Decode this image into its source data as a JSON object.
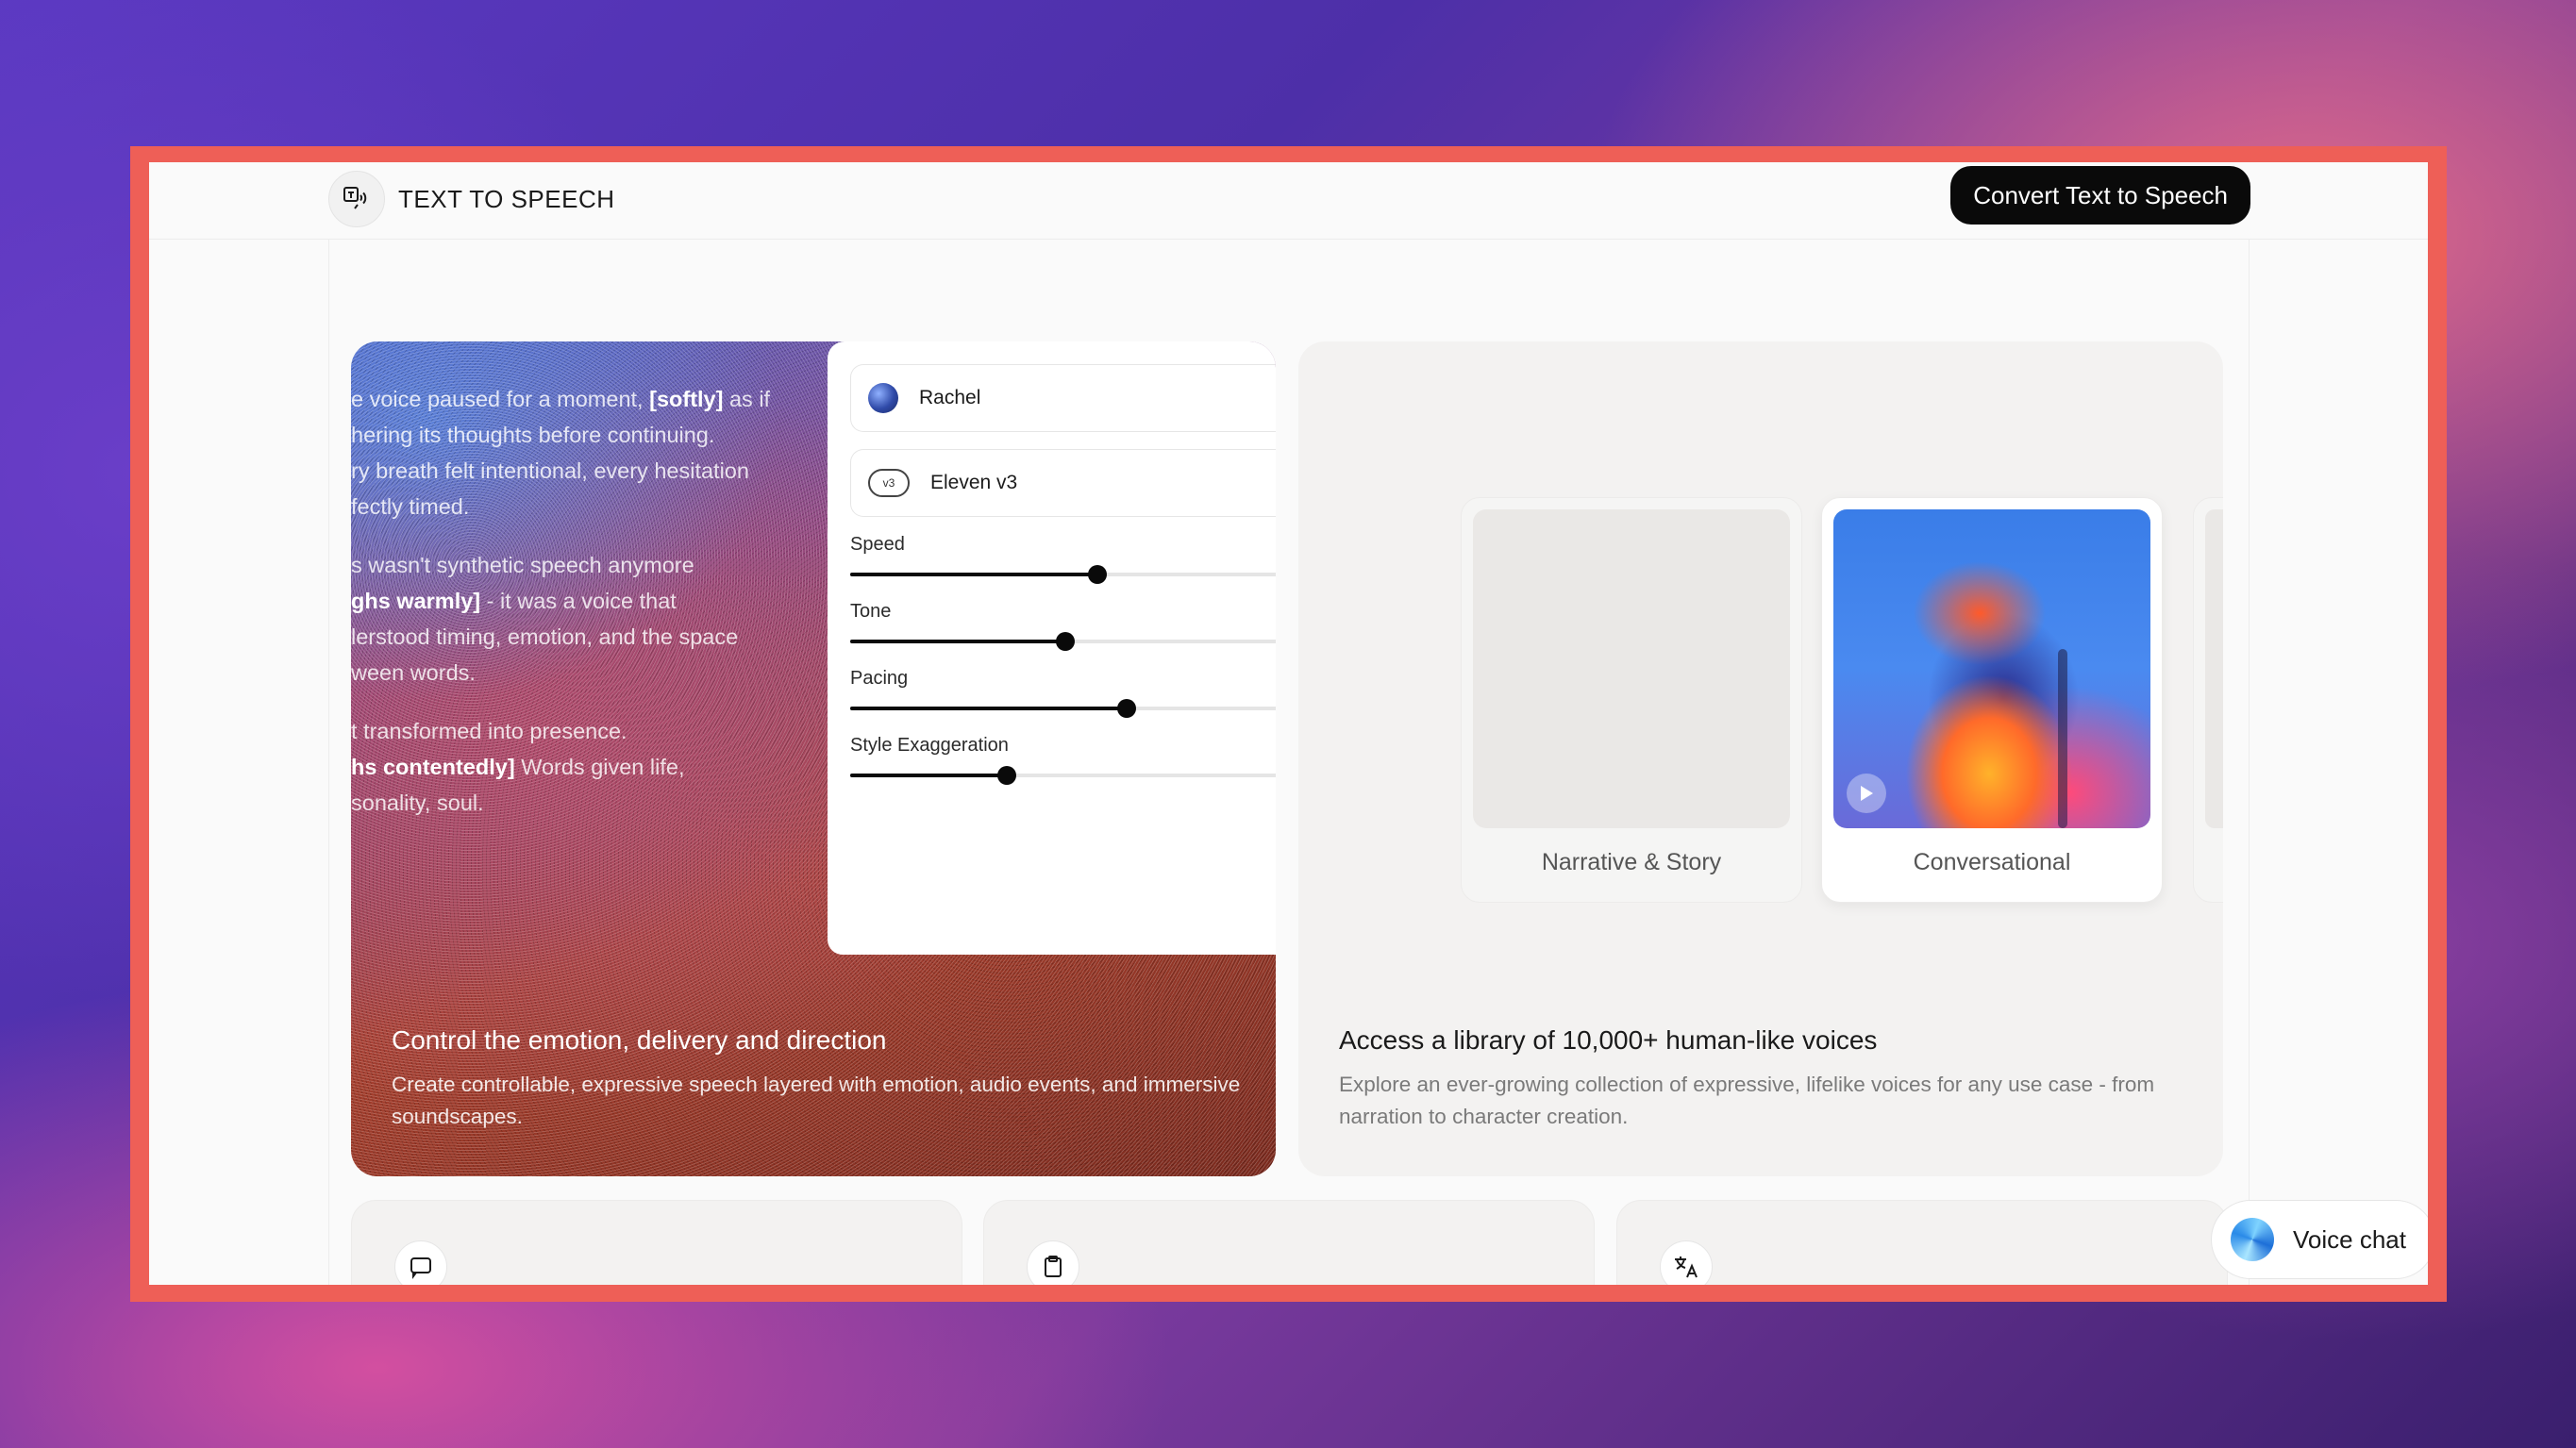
{
  "header": {
    "title": "TEXT TO SPEECH",
    "cta_label": "Convert Text to Speech"
  },
  "left_card": {
    "story_lines": [
      [
        "e voice paused for a moment, ",
        "[softly]",
        " as if"
      ],
      [
        "hering its thoughts before continuing.",
        "",
        ""
      ],
      [
        "ry breath felt intentional, every hesitation",
        "",
        ""
      ],
      [
        "fectly timed.",
        "",
        ""
      ]
    ],
    "story_p1": [
      "e voice paused for a moment, ",
      "[softly]",
      " as if",
      "hering its thoughts before continuing.",
      "ry breath felt intentional, every hesitation",
      "fectly timed."
    ],
    "story_p2": [
      "s wasn't synthetic speech anymore",
      "ghs warmly]",
      " - it was a voice that",
      "lerstood timing, emotion, and the space",
      "ween words."
    ],
    "story_p3": [
      "t transformed into presence.",
      "hs contentedly]",
      " Words given life,",
      "sonality, soul."
    ],
    "voice_select": "Rachel",
    "model_badge": "v3",
    "model_select": "Eleven v3",
    "sliders": [
      {
        "label": "Speed",
        "value": 0.58
      },
      {
        "label": "Tone",
        "value": 0.505
      },
      {
        "label": "Pacing",
        "value": 0.65
      },
      {
        "label": "Style Exaggeration",
        "value": 0.368
      }
    ],
    "caption_title": "Control the emotion, delivery and direction",
    "caption_text": "Create controllable, expressive speech layered with emotion, audio events, and immersive soundscapes."
  },
  "right_card": {
    "voices": [
      {
        "label": "Narrative & Story"
      },
      {
        "label": "Conversational"
      }
    ],
    "caption_title": "Access a library of 10,000+ human-like voices",
    "caption_text": "Explore an ever-growing collection of expressive, lifelike voices for any use case - from narration to character creation."
  },
  "bottom_tiles": [
    {
      "icon": "chat-bubble-icon"
    },
    {
      "icon": "clipboard-icon"
    },
    {
      "icon": "translate-icon"
    }
  ],
  "voice_chat": {
    "label": "Voice chat"
  }
}
